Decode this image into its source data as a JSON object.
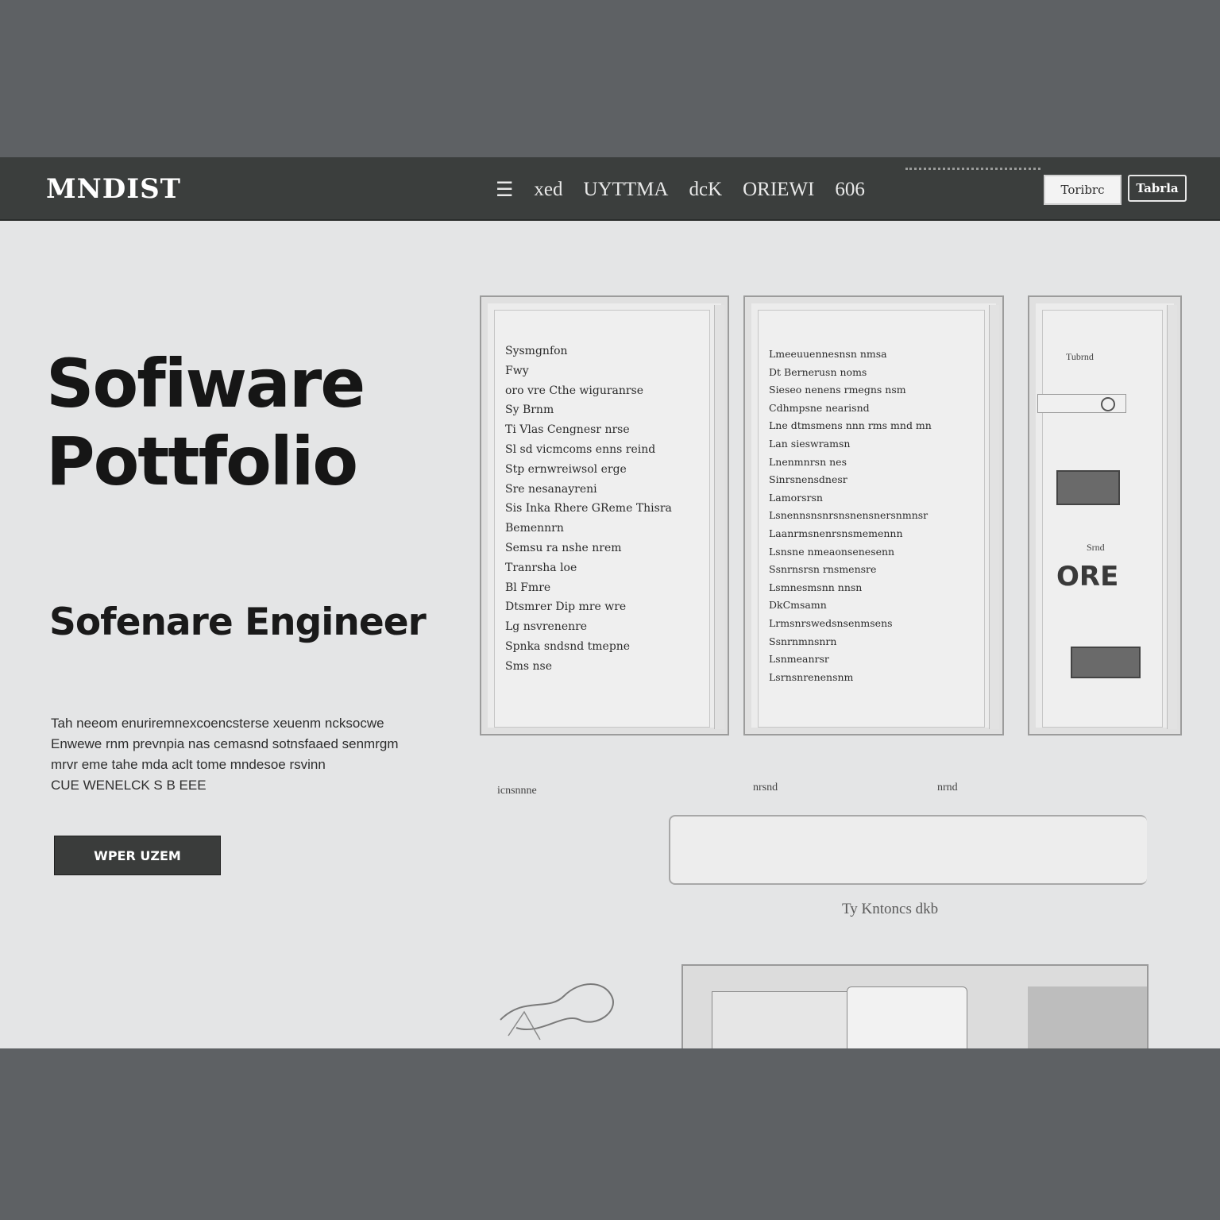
{
  "header": {
    "brand": "MNDIST",
    "nav": [
      "☰",
      "xed",
      "UYTTMA",
      "dcK",
      "ORIEWI",
      "606"
    ],
    "button_outline": "Toribrc",
    "button_dark": "Tabrla"
  },
  "hero": {
    "title_line1": "Sofiware",
    "title_line2": "Pottfolio",
    "subtitle": "Sofenare Engineer",
    "description": [
      "Tah neeom enuriremnexcoencsterse xeuenm ncksocwe",
      "Enwewe rnm prevnpia nas cemasnd sotnsfaaed senmrgm",
      "mrvr eme tahe mda aclt tome mndesoe rsvinn",
      "CUE WENELCK S B EEE"
    ],
    "cta": "WPER UZEM"
  },
  "panels": {
    "left_lines": [
      "Sysmgnfon",
      "Fwy",
      "oro vre Cthe wiguranrse",
      "Sy Brnm",
      "Ti Vlas Cengnesr nrse",
      "Sl sd vicmcoms enns reind",
      "Stp ernwreiwsol erge",
      "Sre nesanayreni",
      "Sis Inka Rhere GReme Thisra",
      "Bemennrn",
      "Semsu ra nshe nrem",
      "Tranrsha loe",
      "Bl Fmre",
      "Dtsmrer Dip mre wre",
      "Lg nsvrenenre",
      "Spnka sndsnd tmepne",
      "Sms nse"
    ],
    "middle_lines": [
      "Lmeeuuennesnsn nmsa",
      "Dt Bernerusn noms",
      "Sieseo nenens rmegns nsm",
      "Cdhmpsne nearisnd",
      "Lne dtmsmens nnn rms mnd mn",
      "Lan sieswramsn",
      "Lnenmnrsn nes",
      "Sinrsnensdnesr",
      "Lamorsrsn",
      "Lsnennsnsnrsnsnensnersnmnsr",
      "Laanrmsnenrsnsmemennn",
      "Lsnsne nmeaonsenesenn",
      "Ssnrnsrsn rnsmensre",
      "Lsmnesmsnn nnsn",
      "DkCmsamn",
      "Lrmsnrswedsnsenmsens",
      "Ssnrnmnsnrn",
      "Lsnmeanrsr",
      "Lsrnsnrenensnm"
    ],
    "right_top": "Tubrnd",
    "right_caption": "Srnd",
    "right_badge": "ORE"
  },
  "captions": [
    "icnsnnne",
    "nrsnd",
    "nrnd"
  ],
  "footer_text": "Ty Kntoncs dkb"
}
